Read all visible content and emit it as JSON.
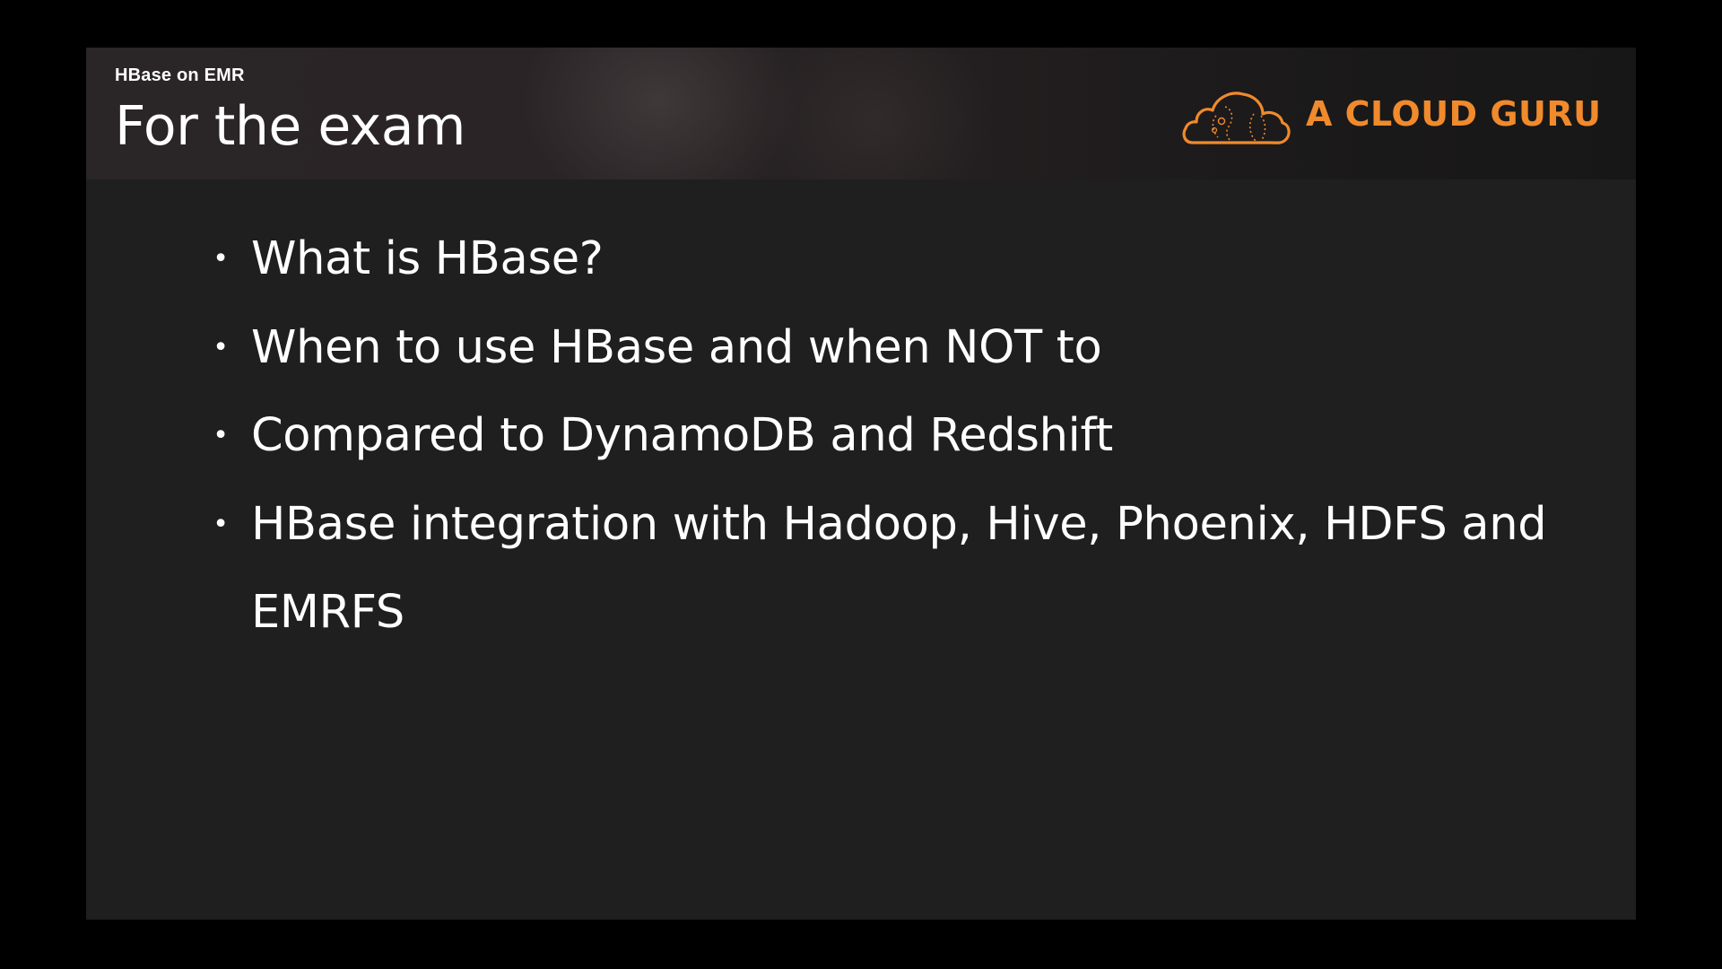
{
  "header": {
    "course_label": "HBase on EMR",
    "title": "For the exam"
  },
  "logo": {
    "text": "A CLOUD GURU",
    "icon": "cloud-logo-icon",
    "color": "#f08a2c"
  },
  "bullets": [
    {
      "marker": "•",
      "text": "What is HBase?"
    },
    {
      "marker": "•",
      "text": "When to use HBase and when NOT to"
    },
    {
      "marker": "•",
      "text": "Compared to DynamoDB and Redshift"
    },
    {
      "marker": "•",
      "text": "HBase integration with Hadoop, Hive, Phoenix, HDFS and EMRFS"
    }
  ],
  "colors": {
    "background": "#000000",
    "slide": "#1f1f1f",
    "text": "#ffffff",
    "accent": "#f08a2c"
  }
}
